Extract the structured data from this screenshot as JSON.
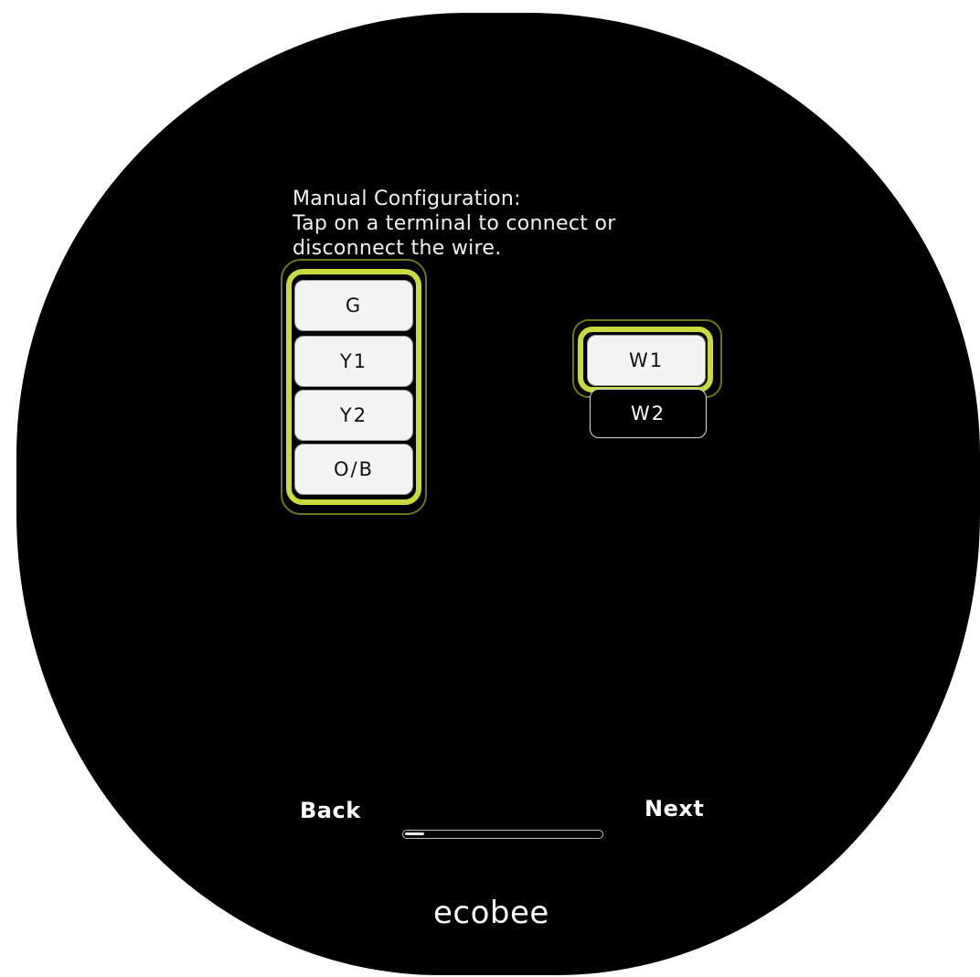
{
  "screen": {
    "instructions": [
      "Manual Configuration:",
      "Tap on a terminal to connect or",
      "disconnect the wire."
    ]
  },
  "terminals": {
    "g": {
      "label": "G",
      "connected": true
    },
    "y1": {
      "label": "Y1",
      "connected": true
    },
    "y2": {
      "label": "Y2",
      "connected": true
    },
    "ob": {
      "label": "O/B",
      "connected": true
    },
    "w1": {
      "label": "W1",
      "connected": true
    },
    "w2": {
      "label": "W2",
      "connected": false
    }
  },
  "navigation": {
    "back_label": "Back",
    "next_label": "Next",
    "progress_fraction": 0.1
  },
  "brand": {
    "logo_text": "ecobee"
  },
  "colors": {
    "highlight": "#c8da3c",
    "background": "#000000",
    "terminal_connected": "#f4f4f4"
  }
}
